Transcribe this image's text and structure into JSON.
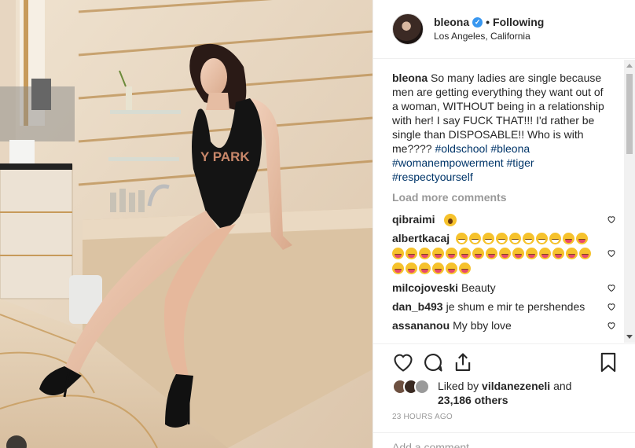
{
  "header": {
    "username": "bleona",
    "verified_icon": "verified-badge-icon",
    "separator": "•",
    "follow_status": "Following",
    "location": "Los Angeles, California"
  },
  "caption": {
    "username": "bleona",
    "text": "So many ladies are single because men are getting everything they want out of a woman, WITHOUT being in a relationship with her! I say FUCK THAT!!! I'd rather be single than DISPOSABLE!! Who is with me????",
    "hashtags": [
      "#oldschool",
      "#bleona",
      "#womanempowerment",
      "#tiger",
      "#respectyourself"
    ]
  },
  "load_more": "Load more comments",
  "comments": [
    {
      "user": "qibraimi",
      "text": "",
      "emoji": "astonished-face"
    },
    {
      "user": "albertkacaj",
      "text": "",
      "emoji": "grinning-and-tongue-faces"
    },
    {
      "user": "milcojoveski",
      "text": "Beauty"
    },
    {
      "user": "dan_b493",
      "text": "je shum e mir te pershendes"
    },
    {
      "user": "assananou",
      "text": "My bby love"
    }
  ],
  "likes": {
    "prefix": "Liked by",
    "user": "vildanezeneli",
    "and": "and",
    "count": "23,186 others"
  },
  "timestamp": "23 HOURS AGO",
  "add_comment_placeholder": "Add a comment…",
  "colors": {
    "hashtag": "#003569",
    "verified": "#3897f0",
    "muted": "#999999"
  }
}
